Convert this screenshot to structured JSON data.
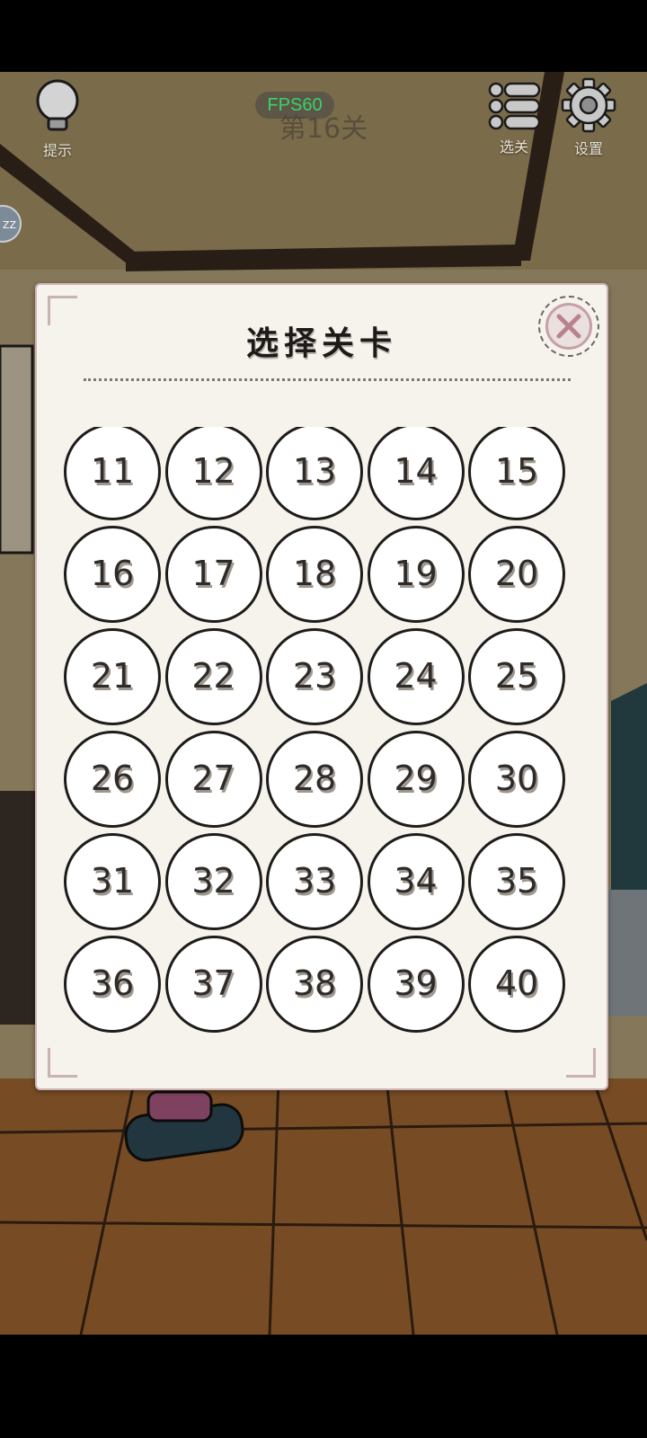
{
  "hud": {
    "hint_label": "提示",
    "level_title": "第16关",
    "fps_label": "FPS60",
    "levels_label": "选关",
    "settings_label": "设置",
    "zz_label": "ZZ"
  },
  "dialog": {
    "title": "选择关卡",
    "close_icon": "close-x-icon",
    "levels": [
      "11",
      "12",
      "13",
      "14",
      "15",
      "16",
      "17",
      "18",
      "19",
      "20",
      "21",
      "22",
      "23",
      "24",
      "25",
      "26",
      "27",
      "28",
      "29",
      "30",
      "31",
      "32",
      "33",
      "34",
      "35",
      "36",
      "37",
      "38",
      "39",
      "40"
    ]
  },
  "colors": {
    "panel_bg": "#f6f2ec",
    "panel_border": "#cfb6b6",
    "accent_pink": "#b8838d",
    "fps_green": "#39d26a"
  }
}
